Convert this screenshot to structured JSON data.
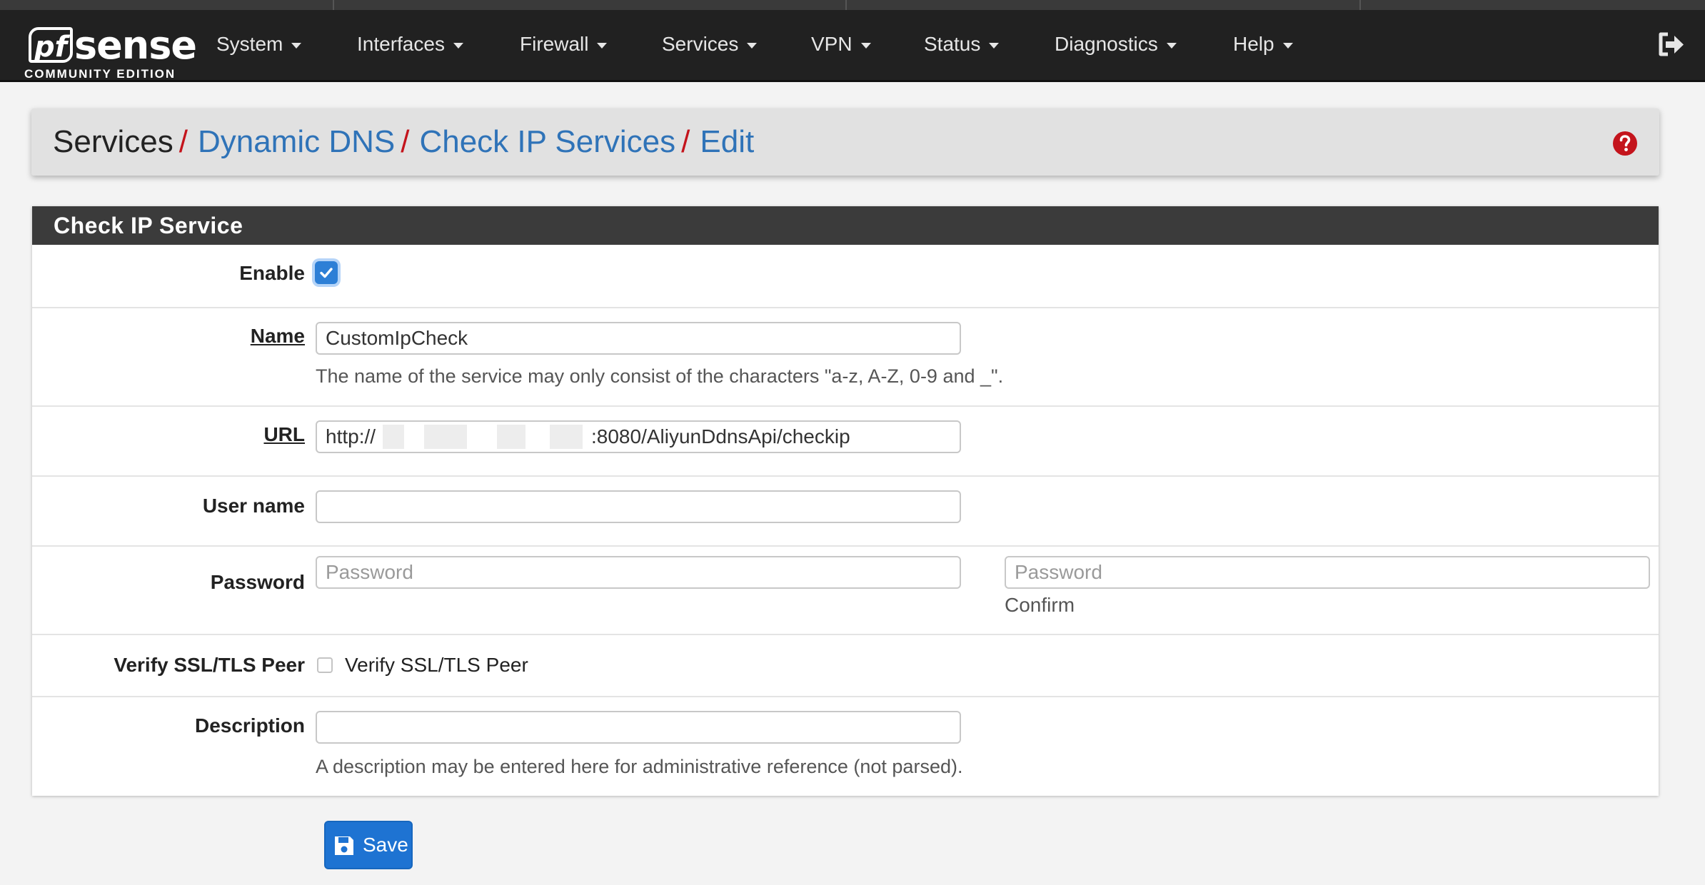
{
  "brand": {
    "logo_pf": "pf",
    "logo_sense": "sense",
    "edition": "COMMUNITY EDITION"
  },
  "nav": {
    "items": [
      {
        "label": "System"
      },
      {
        "label": "Interfaces"
      },
      {
        "label": "Firewall"
      },
      {
        "label": "Services"
      },
      {
        "label": "VPN"
      },
      {
        "label": "Status"
      },
      {
        "label": "Diagnostics"
      },
      {
        "label": "Help"
      }
    ],
    "logout_icon": "sign-out-icon"
  },
  "breadcrumb": {
    "items": [
      {
        "label": "Services"
      },
      {
        "label": "Dynamic DNS"
      },
      {
        "label": "Check IP Services"
      },
      {
        "label": "Edit"
      }
    ],
    "separator": "/",
    "help_icon": "question-circle-icon"
  },
  "panel": {
    "title": "Check IP Service",
    "fields": {
      "enable": {
        "label": "Enable",
        "checked": true
      },
      "name": {
        "label": "Name",
        "value": "CustomIpCheck",
        "help": "The name of the service may only consist of the characters \"a-z, A-Z, 0-9 and _\"."
      },
      "url": {
        "label": "URL",
        "value": "http://",
        "value_suffix": ":8080/AliyunDdnsApi/checkip"
      },
      "username": {
        "label": "User name",
        "value": ""
      },
      "password": {
        "label": "Password",
        "placeholder": "Password",
        "confirm_placeholder": "Password",
        "confirm_label": "Confirm"
      },
      "verify_ssl": {
        "label": "Verify SSL/TLS Peer",
        "checkbox_label": "Verify SSL/TLS Peer",
        "checked": false
      },
      "description": {
        "label": "Description",
        "value": "",
        "help": "A description may be entered here for administrative reference (not parsed)."
      }
    }
  },
  "actions": {
    "save_label": "Save",
    "save_icon": "floppy-disk-icon"
  },
  "colors": {
    "navbar": "#212121",
    "link": "#2f73b8",
    "separator": "#c4141c",
    "primary_button": "#1e73d2"
  }
}
